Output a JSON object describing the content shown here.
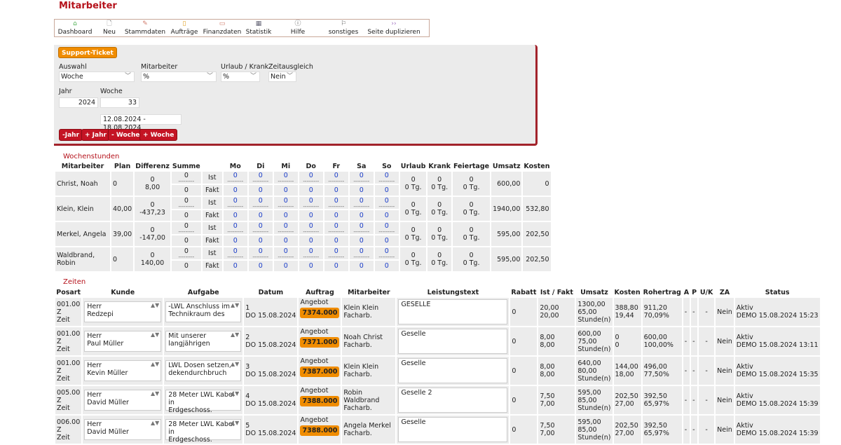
{
  "page": {
    "title": "Mitarbeiter"
  },
  "toolbar": [
    {
      "label": "Dashboard",
      "icon": "home-icon"
    },
    {
      "label": "Neu",
      "icon": "new-document-icon"
    },
    {
      "label": "Stammdaten",
      "icon": "edit-document-icon"
    },
    {
      "label": "Aufträge",
      "icon": "clipboard-icon"
    },
    {
      "label": "Finanzdaten",
      "icon": "money-icon"
    },
    {
      "label": "Statistik",
      "icon": "chart-icon"
    },
    {
      "label": "Hilfe",
      "icon": "info-icon"
    },
    {
      "label": "sonstiges",
      "icon": "flag-icon"
    },
    {
      "label": "Seite duplizieren",
      "icon": "double-chevron-icon"
    }
  ],
  "filter": {
    "support_ticket": "Support-Ticket",
    "auswahl_label": "Auswahl",
    "auswahl_value": "Woche",
    "mitarbeiter_label": "Mitarbeiter",
    "mitarbeiter_value": "%",
    "urlaub_label": "Urlaub / Krank",
    "urlaub_value": "%",
    "zeitausgleich_label": "Zeitausgleich",
    "zeitausgleich_value": "Nein",
    "jahr_label": "Jahr",
    "jahr_value": "2024",
    "woche_label": "Woche",
    "woche_value": "33",
    "range": "12.08.2024 - 18.08.2024",
    "buttons": [
      "-Jahr",
      "+ Jahr",
      "- Woche",
      "+ Woche"
    ]
  },
  "wochenstunden": {
    "heading": "Wochenstunden",
    "headers": [
      "Mitarbeiter",
      "Plan",
      "Differenz",
      "Summe",
      "",
      "Mo",
      "Di",
      "Mi",
      "Do",
      "Fr",
      "Sa",
      "So",
      "Urlaub",
      "Krank",
      "Feiertage",
      "Umsatz",
      "Kosten"
    ],
    "ist_label": "Ist",
    "fakt_label": "Fakt",
    "dash": "---------",
    "rows": [
      {
        "name": "Christ, Noah",
        "plan": "0",
        "diff_top": "0",
        "diff": "8,00",
        "summe_ist": "0",
        "summe_fakt": "0",
        "days_ist": [
          "0",
          "0",
          "0",
          "0",
          "0",
          "0",
          "0"
        ],
        "days_fakt": [
          "0",
          "0",
          "0",
          "0",
          "0",
          "0",
          "0"
        ],
        "urlaub": "0 Tg.",
        "krank": "0 Tg.",
        "feiertage": "0 Tg.",
        "umsatz": "600,00",
        "kosten": "0"
      },
      {
        "name": "Klein, Klein",
        "plan": "40,00",
        "diff_top": "0",
        "diff": "-437,23",
        "summe_ist": "0",
        "summe_fakt": "0",
        "days_ist": [
          "0",
          "0",
          "0",
          "0",
          "0",
          "0",
          "0"
        ],
        "days_fakt": [
          "0",
          "0",
          "0",
          "0",
          "0",
          "0",
          "0"
        ],
        "urlaub": "0 Tg.",
        "krank": "0 Tg.",
        "feiertage": "0 Tg.",
        "umsatz": "1940,00",
        "kosten": "532,80"
      },
      {
        "name": "Merkel, Angela",
        "plan": "39,00",
        "diff_top": "0",
        "diff": "-147,00",
        "summe_ist": "0",
        "summe_fakt": "0",
        "days_ist": [
          "0",
          "0",
          "0",
          "0",
          "0",
          "0",
          "0"
        ],
        "days_fakt": [
          "0",
          "0",
          "0",
          "0",
          "0",
          "0",
          "0"
        ],
        "urlaub": "0 Tg.",
        "krank": "0 Tg.",
        "feiertage": "0 Tg.",
        "umsatz": "595,00",
        "kosten": "202,50"
      },
      {
        "name": "Waldbrand, Robin",
        "plan": "0",
        "diff_top": "0",
        "diff": "140,00",
        "summe_ist": "0",
        "summe_fakt": "0",
        "days_ist": [
          "0",
          "0",
          "0",
          "0",
          "0",
          "0",
          "0"
        ],
        "days_fakt": [
          "0",
          "0",
          "0",
          "0",
          "0",
          "0",
          "0"
        ],
        "urlaub": "0 Tg.",
        "krank": "0 Tg.",
        "feiertage": "0 Tg.",
        "umsatz": "595,00",
        "kosten": "202,50"
      }
    ]
  },
  "zeiten": {
    "heading": "Zeiten",
    "headers": [
      "Posart",
      "Kunde",
      "Aufgabe",
      "Datum",
      "Auftrag",
      "Mitarbeiter",
      "Leistungstext",
      "Rabatt",
      "Ist / Fakt",
      "Umsatz",
      "Kosten",
      "Rohertrag",
      "A",
      "P",
      "U/K",
      "ZA",
      "Status"
    ],
    "rows": [
      {
        "posart": [
          "001.00",
          "Z",
          "Zeit"
        ],
        "kunde": [
          "Herr",
          "Redzepi"
        ],
        "aufgabe": [
          "-LWL Anschluss im",
          "Technikraum des"
        ],
        "nr": "1",
        "datum": "DO 15.08.2024",
        "auftrag_label": "Angebot",
        "auftrag_nr": "7374.000",
        "mitarbeiter": [
          "Klein Klein",
          "Facharb."
        ],
        "leistung": "GESELLE",
        "rabatt": "0",
        "ist": "20,00",
        "fakt": "20,00",
        "umsatz": [
          "1300,00",
          "65,00",
          "Stunde(n)"
        ],
        "kosten": [
          "388,80",
          "19,44"
        ],
        "rohertrag": [
          "911,20",
          "70,09%"
        ],
        "a": "-",
        "p": "-",
        "uk": "-",
        "za": "Nein",
        "status": [
          "Aktiv",
          "DEMO 15.08.2024 15:23"
        ]
      },
      {
        "posart": [
          "001.00",
          "Z",
          "Zeit"
        ],
        "kunde": [
          "Herr",
          "Paul Müller"
        ],
        "aufgabe": [
          "Mit unserer",
          "langjährigen"
        ],
        "nr": "2",
        "datum": "DO 15.08.2024",
        "auftrag_label": "Angebot",
        "auftrag_nr": "7371.000",
        "mitarbeiter": [
          "Noah Christ",
          "Facharb."
        ],
        "leistung": "Geselle",
        "rabatt": "0",
        "ist": "8,00",
        "fakt": "8,00",
        "umsatz": [
          "600,00",
          "75,00",
          "Stunde(n)"
        ],
        "kosten": [
          "0",
          "0"
        ],
        "rohertrag": [
          "600,00",
          "100,00%"
        ],
        "a": "-",
        "p": "-",
        "uk": "-",
        "za": "Nein",
        "status": [
          "Aktiv",
          "DEMO 15.08.2024 13:11"
        ]
      },
      {
        "posart": [
          "001.00",
          "Z",
          "Zeit"
        ],
        "kunde": [
          "Herr",
          "Kevin Müller"
        ],
        "aufgabe": [
          "LWL Dosen setzen,",
          "dekendurchbruch"
        ],
        "nr": "3",
        "datum": "DO 15.08.2024",
        "auftrag_label": "Angebot",
        "auftrag_nr": "7387.000",
        "mitarbeiter": [
          "Klein Klein",
          "Facharb."
        ],
        "leistung": "Geselle",
        "rabatt": "0",
        "ist": "8,00",
        "fakt": "8,00",
        "umsatz": [
          "640,00",
          "80,00",
          "Stunde(n)"
        ],
        "kosten": [
          "144,00",
          "18,00"
        ],
        "rohertrag": [
          "496,00",
          "77,50%"
        ],
        "a": "-",
        "p": "-",
        "uk": "-",
        "za": "Nein",
        "status": [
          "Aktiv",
          "DEMO 15.08.2024 15:35"
        ]
      },
      {
        "posart": [
          "005.00",
          "Z",
          "Zeit"
        ],
        "kunde": [
          "Herr",
          "David Müller"
        ],
        "aufgabe": [
          "28 Meter LWL Kabel in",
          "Erdgeschoss."
        ],
        "nr": "4",
        "datum": "DO 15.08.2024",
        "auftrag_label": "Angebot",
        "auftrag_nr": "7388.000",
        "mitarbeiter": [
          "Robin Waldbrand",
          "Facharb."
        ],
        "leistung": "Geselle 2",
        "rabatt": "0",
        "ist": "7,50",
        "fakt": "7,00",
        "umsatz": [
          "595,00",
          "85,00",
          "Stunde(n)"
        ],
        "kosten": [
          "202,50",
          "27,00"
        ],
        "rohertrag": [
          "392,50",
          "65,97%"
        ],
        "a": "-",
        "p": "-",
        "uk": "-",
        "za": "Nein",
        "status": [
          "Aktiv",
          "DEMO 15.08.2024 15:39"
        ]
      },
      {
        "posart": [
          "006.00",
          "Z",
          "Zeit"
        ],
        "kunde": [
          "Herr",
          "David Müller"
        ],
        "aufgabe": [
          "28 Meter LWL Kabel in",
          "Erdgeschoss."
        ],
        "nr": "5",
        "datum": "DO 15.08.2024",
        "auftrag_label": "Angebot",
        "auftrag_nr": "7388.000",
        "mitarbeiter": [
          "Angela Merkel",
          "Facharb."
        ],
        "leistung": "Geselle",
        "rabatt": "0",
        "ist": "7,50",
        "fakt": "7,00",
        "umsatz": [
          "595,00",
          "85,00",
          "Stunde(n)"
        ],
        "kosten": [
          "202,50",
          "27,00"
        ],
        "rohertrag": [
          "392,50",
          "65,97%"
        ],
        "a": "-",
        "p": "-",
        "uk": "-",
        "za": "Nein",
        "status": [
          "Aktiv",
          "DEMO 15.08.2024 15:39"
        ]
      }
    ]
  }
}
